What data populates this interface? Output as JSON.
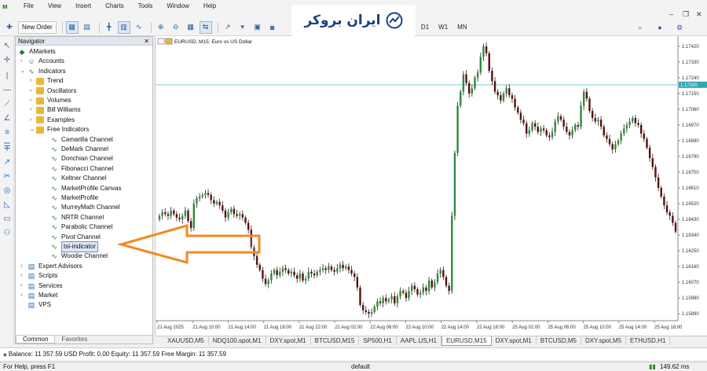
{
  "menu": {
    "items": [
      "File",
      "View",
      "Insert",
      "Charts",
      "Tools",
      "Window",
      "Help"
    ],
    "window_buttons": [
      "‒",
      "❐",
      "✕"
    ]
  },
  "toolbar": {
    "new_order": "New Order",
    "timeframes": [
      "H4",
      "D1",
      "W1",
      "MN"
    ]
  },
  "brand": {
    "text": "ایران بروکر"
  },
  "navigator": {
    "title": "Navigator",
    "close": "✕",
    "root": "AMarkets",
    "accounts": "Accounts",
    "indicators": "Indicators",
    "folders": [
      "Trend",
      "Oscillators",
      "Volumes",
      "Bill Williams",
      "Examples",
      "Free Indicators"
    ],
    "free_indicators": [
      "Camarilla Channel",
      "DeMark Channel",
      "Donchian Channel",
      "Fibonacci Channel",
      "Keltner Channel",
      "MarketProfile Canvas",
      "MarketProfile",
      "MurreyMath Channel",
      "NRTR Channel",
      "Parabolic Channel",
      "Pivot Channel",
      "tsi-indicator",
      "Woodie Channel"
    ],
    "bottom": [
      "Expert Advisors",
      "Scripts",
      "Services",
      "Market",
      "VPS"
    ],
    "tabs": [
      "Common",
      "Favorites"
    ]
  },
  "chart": {
    "title": "EURUSD, M15:  Euro vs US Dollar",
    "price_label": "1.17200",
    "yticks": [
      "1.17420",
      "1.17330",
      "1.17240",
      "1.17150",
      "1.17060",
      "1.16970",
      "1.16880",
      "1.16790",
      "1.16700",
      "1.16610",
      "1.16520",
      "1.16430",
      "1.16340",
      "1.16250",
      "1.16160",
      "1.16070",
      "1.15980",
      "1.15890"
    ],
    "xticks": [
      "21 Aug 2025",
      "21 Aug 10:00",
      "21 Aug 14:00",
      "21 Aug 18:00",
      "21 Aug 22:00",
      "22 Aug 02:00",
      "22 Aug 06:00",
      "22 Aug 10:00",
      "22 Aug 14:00",
      "22 Aug 18:00",
      "25 Aug 02:00",
      "25 Aug 06:00",
      "25 Aug 10:00",
      "25 Aug 14:00",
      "25 Aug 18:00"
    ]
  },
  "chart_data": {
    "type": "candlestick",
    "title": "EURUSD, M15:  Euro vs US Dollar",
    "ylim": [
      1.1585,
      1.1746
    ],
    "current_price": 1.172,
    "close": [
      1.1645,
      1.1647,
      1.1646,
      1.1645,
      1.1648,
      1.1646,
      1.1644,
      1.1643,
      1.1645,
      1.1648,
      1.1642,
      1.1638,
      1.1652,
      1.1655,
      1.1656,
      1.1657,
      1.1658,
      1.1657,
      1.1654,
      1.1652,
      1.1653,
      1.1651,
      1.1648,
      1.1644,
      1.1647,
      1.1649,
      1.1646,
      1.1645,
      1.1646,
      1.1644,
      1.1641,
      1.1637,
      1.1627,
      1.1622,
      1.1617,
      1.1614,
      1.1609,
      1.1606,
      1.1608,
      1.1612,
      1.1614,
      1.1611,
      1.1613,
      1.1615,
      1.1614,
      1.1612,
      1.1613,
      1.1611,
      1.1609,
      1.1612,
      1.1608,
      1.1609,
      1.1613,
      1.1612,
      1.1611,
      1.1613,
      1.1614,
      1.1615,
      1.1614,
      1.1616,
      1.1614,
      1.1613,
      1.1615,
      1.1617,
      1.1615,
      1.1616,
      1.1614,
      1.1612,
      1.161,
      1.1604,
      1.1594,
      1.1591,
      1.159,
      1.1589,
      1.159,
      1.1593,
      1.1596,
      1.1595,
      1.1598,
      1.1596,
      1.1597,
      1.1599,
      1.1595,
      1.1599,
      1.1602,
      1.1601,
      1.1598,
      1.1602,
      1.1605,
      1.1603,
      1.16,
      1.1601,
      1.1604,
      1.1602,
      1.1608,
      1.1604,
      1.1607,
      1.1612,
      1.1614,
      1.161,
      1.1605,
      1.1602,
      1.1645,
      1.1681,
      1.1708,
      1.1716,
      1.1726,
      1.1721,
      1.1715,
      1.1718,
      1.1724,
      1.1727,
      1.1736,
      1.1742,
      1.1738,
      1.1728,
      1.1722,
      1.1716,
      1.1714,
      1.1711,
      1.1715,
      1.1718,
      1.1714,
      1.1712,
      1.1707,
      1.1704,
      1.17,
      1.1698,
      1.1692,
      1.1694,
      1.1698,
      1.1696,
      1.1693,
      1.1695,
      1.1694,
      1.1691,
      1.169,
      1.1693,
      1.1699,
      1.1702,
      1.17,
      1.1696,
      1.1693,
      1.1691,
      1.1694,
      1.1697,
      1.1696,
      1.1708,
      1.1716,
      1.1712,
      1.1705,
      1.1701,
      1.1699,
      1.17,
      1.1696,
      1.1691,
      1.1689,
      1.1686,
      1.1683,
      1.1686,
      1.1688,
      1.1692,
      1.1695,
      1.1697,
      1.1699,
      1.1701,
      1.1698,
      1.1697,
      1.1692,
      1.1689,
      1.1684,
      1.1678,
      1.1673,
      1.1667,
      1.1661,
      1.1656,
      1.1651,
      1.1647,
      1.1645,
      1.1641,
      1.1636
    ]
  },
  "symbol_tabs": [
    "XAUUSD,M5",
    "NDQ100.spot,M1",
    "DXY.spot,M1",
    "BTCUSD,M15",
    "SP500,H1",
    "AAPL.US,H1",
    "EURUSD,M15",
    "DXY.spot,M1",
    "BTCUSD,M5",
    "DXY.spot,M5",
    "ETHUSD,H1"
  ],
  "account": {
    "text": "Balance: 11 357.59 USD  Profit: 0.00  Equity: 11 357.59  Free Margin: 11 357.59"
  },
  "status": {
    "help": "For Help, press F1",
    "profile": "default",
    "traffic": "149.62 ms"
  }
}
